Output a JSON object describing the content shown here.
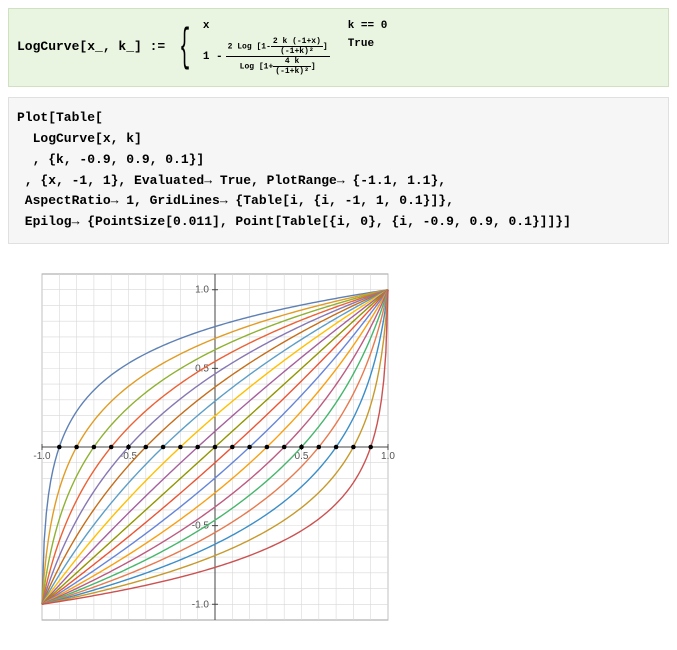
{
  "definition": {
    "lhs": "LogCurve[x_, k_] :=",
    "row0_expr": "x",
    "row0_cond": "k == 0",
    "row1_prefix": "1 -",
    "row1_numA": "2 Log",
    "row1_numB_num": "2 k (-1+x)",
    "row1_numB_den": "(-1+k)²",
    "row1_denA": "Log",
    "row1_denB_num": "4 k",
    "row1_denB_den": "(-1+k)²",
    "row1_cond": "True"
  },
  "plot_code": {
    "l1": "Plot[Table[",
    "l2": "  LogCurve[x, k]",
    "l3": "  , {k, -0.9, 0.9, 0.1}]",
    "l4": " , {x, -1, 1}, Evaluated→ True, PlotRange→ {-1.1, 1.1},",
    "l5": " AspectRatio→ 1, GridLines→ {Table[i, {i, -1, 1, 0.1}]},",
    "l6": " Epilog→ {PointSize[0.011], Point[Table[{i, 0}, {i, -0.9, 0.9, 0.1}]]}]"
  },
  "chart_data": {
    "type": "line",
    "title": "",
    "xlabel": "",
    "ylabel": "",
    "xlim": [
      -1,
      1
    ],
    "ylim": [
      -1.1,
      1.1
    ],
    "aspect_ratio": 1,
    "grid_x_lines": [
      -1,
      -0.9,
      -0.8,
      -0.7,
      -0.6,
      -0.5,
      -0.4,
      -0.3,
      -0.2,
      -0.1,
      0,
      0.1,
      0.2,
      0.3,
      0.4,
      0.5,
      0.6,
      0.7,
      0.8,
      0.9,
      1
    ],
    "x_ticks": [
      {
        "v": -1,
        "l": "-1.0"
      },
      {
        "v": -0.5,
        "l": "-0.5"
      },
      {
        "v": 0.5,
        "l": "0.5"
      },
      {
        "v": 1,
        "l": "1.0"
      }
    ],
    "y_ticks": [
      {
        "v": -1,
        "l": "-1.0"
      },
      {
        "v": -0.5,
        "l": "-0.5"
      },
      {
        "v": 0.5,
        "l": "0.5"
      },
      {
        "v": 1,
        "l": "1.0"
      }
    ],
    "k_values": [
      -0.9,
      -0.8,
      -0.7,
      -0.6,
      -0.5,
      -0.4,
      -0.3,
      -0.2,
      -0.1,
      0.0,
      0.1,
      0.2,
      0.3,
      0.4,
      0.5,
      0.6,
      0.7,
      0.8,
      0.9
    ],
    "colors": [
      "#5e81b5",
      "#e19c24",
      "#8fb131",
      "#eb6235",
      "#8778b3",
      "#c56e1a",
      "#5d9ec7",
      "#ffbf00",
      "#a5609d",
      "#929600",
      "#e95536",
      "#6685d9",
      "#f89f13",
      "#bc5b80",
      "#47b66d",
      "#e67a50",
      "#3b8ec7",
      "#c8992b",
      "#cc5151"
    ],
    "epilog_points_x": [
      -0.9,
      -0.8,
      -0.7,
      -0.6,
      -0.5,
      -0.4,
      -0.3,
      -0.2,
      -0.1,
      0,
      0.1,
      0.2,
      0.3,
      0.4,
      0.5,
      0.6,
      0.7,
      0.8,
      0.9
    ],
    "function": "y = x when k==0; else y = 1 - 2*ln(1 - 2k(x-1)/(k-1)^2) / ln(1 + 4k/(k-1)^2)"
  }
}
